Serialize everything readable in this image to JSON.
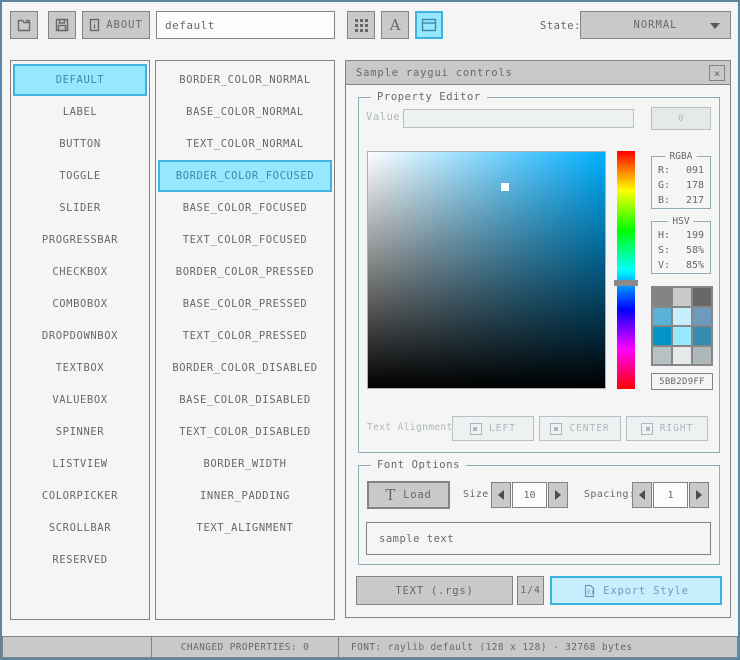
{
  "colors": {
    "bg": "#f5f5f5",
    "frame": "#5b86a2",
    "border_normal": "#838383",
    "base_normal": "#c9c9c9",
    "text_normal": "#686868",
    "border_focused": "#5bb2d9",
    "base_focused": "#c8effe",
    "text_focused": "#6c9bbc",
    "border_pressed": "#3fb2e4",
    "base_pressed": "#97e8ff",
    "text_pressed": "#368baf",
    "border_disabled": "#b5c1c2",
    "base_disabled": "#e6e9e9",
    "text_disabled": "#aeb7ba",
    "line": "#90abb5"
  },
  "toolbar": {
    "icons": {
      "open": "folder-open-icon",
      "save": "floppy-disk-icon",
      "about": "info-icon",
      "style_table": "grid-icon",
      "font_atlas": "font-a-icon",
      "controls_panel": "window-icon"
    },
    "about_label": "ABOUT",
    "style_name_value": "default",
    "state_label": "State:",
    "state_value": "NORMAL"
  },
  "controls_list": {
    "selected_index": 0,
    "items": [
      "DEFAULT",
      "LABEL",
      "BUTTON",
      "TOGGLE",
      "SLIDER",
      "PROGRESSBAR",
      "CHECKBOX",
      "COMBOBOX",
      "DROPDOWNBOX",
      "TEXTBOX",
      "VALUEBOX",
      "SPINNER",
      "LISTVIEW",
      "COLORPICKER",
      "SCROLLBAR",
      "RESERVED"
    ]
  },
  "properties_list": {
    "selected_index": 3,
    "items": [
      "BORDER_COLOR_NORMAL",
      "BASE_COLOR_NORMAL",
      "TEXT_COLOR_NORMAL",
      "BORDER_COLOR_FOCUSED",
      "BASE_COLOR_FOCUSED",
      "TEXT_COLOR_FOCUSED",
      "BORDER_COLOR_PRESSED",
      "BASE_COLOR_PRESSED",
      "TEXT_COLOR_PRESSED",
      "BORDER_COLOR_DISABLED",
      "BASE_COLOR_DISABLED",
      "TEXT_COLOR_DISABLED",
      "BORDER_WIDTH",
      "INNER_PADDING",
      "TEXT_ALIGNMENT"
    ]
  },
  "window": {
    "title": "Sample raygui controls",
    "close_label": "×",
    "property_editor": {
      "title": "Property Editor",
      "value_label": "Value:",
      "value_text": "",
      "value_button_label": "0",
      "rgba_title": "RGBA",
      "rgba_rows": [
        {
          "label": "R:",
          "value": "091"
        },
        {
          "label": "G:",
          "value": "178"
        },
        {
          "label": "B:",
          "value": "217"
        }
      ],
      "hsv_title": "HSV",
      "hsv_rows": [
        {
          "label": "H:",
          "value": "199"
        },
        {
          "label": "S:",
          "value": "58%"
        },
        {
          "label": "V:",
          "value": "85%"
        }
      ],
      "picker": {
        "hue": 199,
        "saturation_pct": 58,
        "value_pct": 85,
        "hex": "5BB2D9FF",
        "rgb_hex": "#5bb2d9"
      },
      "style_swatches": [
        "#838383",
        "#c9c9c9",
        "#686868",
        "#5bb2d9",
        "#c8effe",
        "#6c9bbc",
        "#0492c7",
        "#97e8ff",
        "#368baf",
        "#b5c1c2",
        "#e6e9e9",
        "#aeb7ba"
      ],
      "hex_value": "5BB2D9FF",
      "text_alignment_label": "Text Alignment:",
      "alignment_buttons": [
        "LEFT",
        "CENTER",
        "RIGHT"
      ]
    },
    "font_options": {
      "title": "Font Options",
      "load_button_label": "Load",
      "size_label": "Size:",
      "size_value": "10",
      "spacing_label": "Spacing:",
      "spacing_value": "1",
      "sample_text": "sample text"
    },
    "export_bar": {
      "format_button_label": "TEXT (.rgs)",
      "page_indicator": "1/4",
      "export_button_label": "Export Style",
      "export_icon": "export-file-icon"
    }
  },
  "statusbar": {
    "left": "",
    "changed_properties": "CHANGED PROPERTIES: 0",
    "font_info": "FONT: raylib default (128 x 128) - 32768 bytes"
  }
}
